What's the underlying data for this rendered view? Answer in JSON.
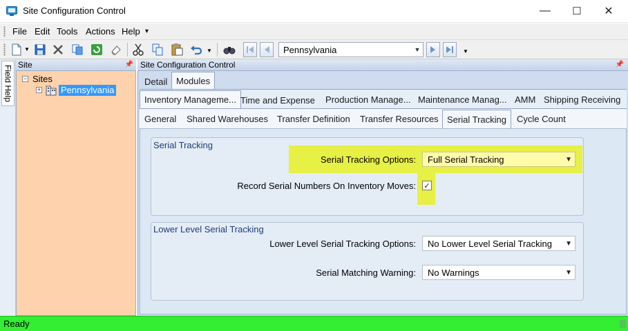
{
  "window": {
    "title": "Site Configuration Control",
    "minimize_glyph": "—",
    "maximize_glyph": "☐",
    "close_glyph": "✕"
  },
  "menu": {
    "items": [
      "File",
      "Edit",
      "Tools",
      "Actions",
      "Help"
    ],
    "overflow_glyph": "▾"
  },
  "toolbar": {
    "site_value": "Pennsylvania",
    "icons": [
      "new-icon",
      "save-icon",
      "delete-icon",
      "copy-icon",
      "refresh-icon",
      "clear-icon",
      "cut-icon",
      "copy-clipboard-icon",
      "paste-icon",
      "undo-icon",
      "find-icon",
      "first-icon",
      "previous-icon",
      "next-icon",
      "last-icon"
    ]
  },
  "field_help": {
    "label": "Field Help"
  },
  "site_panel": {
    "title": "Site",
    "tree": {
      "root": "Sites",
      "child": "Pennsylvania"
    }
  },
  "main_panel": {
    "title": "Site Configuration Control",
    "tabs_level1": [
      "Detail",
      "Modules"
    ],
    "tabs_level2": [
      "Inventory Manageme...",
      "Time and Expense",
      "Production Manage...",
      "Maintenance Manag...",
      "AMM",
      "Shipping Receiving"
    ],
    "tabs_level3": [
      "General",
      "Shared Warehouses",
      "Transfer Definition",
      "Transfer Resources",
      "Serial Tracking",
      "Cycle Count"
    ]
  },
  "serial_tracking_group": {
    "title": "Serial Tracking",
    "options_label": "Serial Tracking Options:",
    "options_value": "Full Serial Tracking",
    "record_label": "Record Serial Numbers On Inventory Moves:",
    "record_checked": true
  },
  "lower_level_group": {
    "title": "Lower Level Serial Tracking",
    "options_label": "Lower Level Serial Tracking Options:",
    "options_value": "No Lower Level Serial Tracking",
    "warning_label": "Serial Matching Warning:",
    "warning_value": "No Warnings"
  },
  "status": {
    "text": "Ready"
  },
  "colors": {
    "highlight": "#e6f045",
    "status_bar": "#33ee33",
    "site_panel": "#fdd2ac",
    "tree_selection": "#3399ff"
  }
}
